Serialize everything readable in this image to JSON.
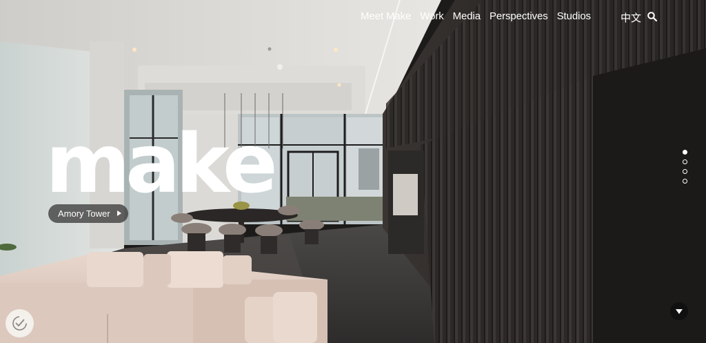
{
  "nav": {
    "items": [
      "Meet Make",
      "Work",
      "Media",
      "Perspectives",
      "Studios"
    ],
    "language": "中文",
    "search_icon": "search-icon"
  },
  "hero": {
    "logo_text": "make",
    "project_label": "Amory Tower",
    "project_icon": "play-triangle-icon"
  },
  "slider": {
    "total": 4,
    "active": 1
  },
  "scroll_icon": "chevron-down-icon",
  "cookie_icon": "cookie-consent-icon",
  "colors": {
    "text": "#ffffff",
    "pill_bg": "#3c3c3c",
    "scroll_btn": "#101010"
  }
}
